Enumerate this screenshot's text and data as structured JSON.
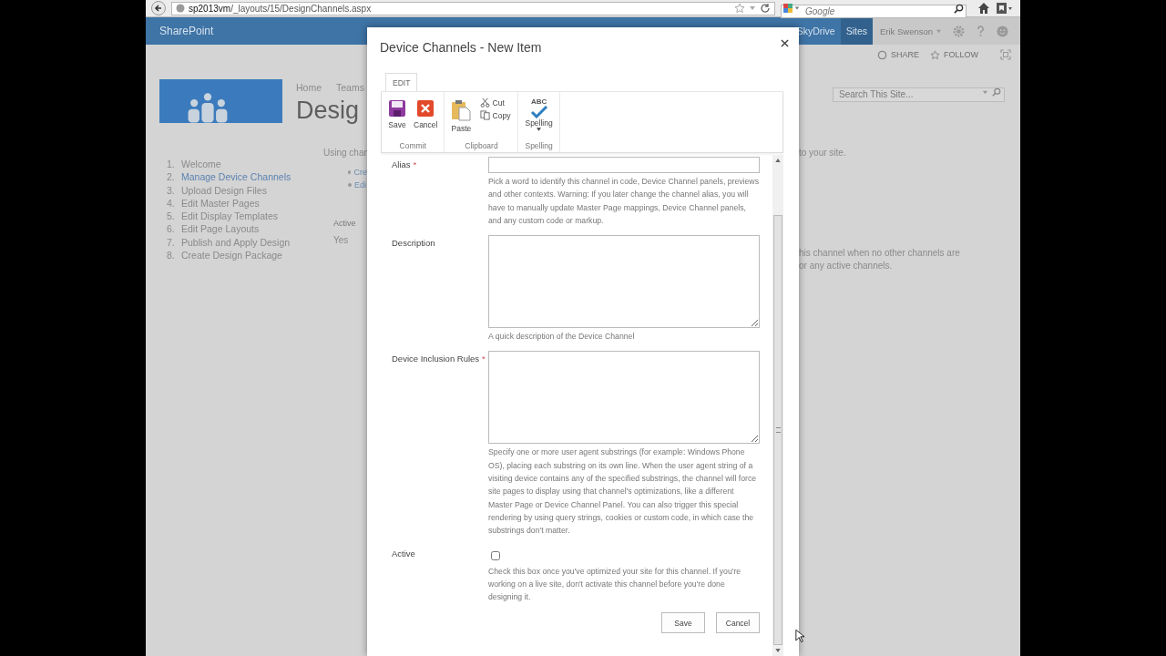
{
  "browser": {
    "url_host": "sp2013vm",
    "url_path": "/_layouts/15/DesignChannels.aspx",
    "search_placeholder": "Google"
  },
  "suite_bar": {
    "brand": "SharePoint",
    "links": [
      {
        "label": "SkyDrive",
        "selected": false
      },
      {
        "label": "Sites",
        "selected": true
      }
    ],
    "user": "Erik Swenson"
  },
  "page_actions": [
    {
      "kind": "share",
      "label": "SHARE"
    },
    {
      "kind": "follow",
      "label": "FOLLOW"
    }
  ],
  "top_nav": [
    "Home",
    "Teams"
  ],
  "page_title": "Desig",
  "site_search": {
    "placeholder": "Search This Site..."
  },
  "steps": [
    {
      "number": "1.",
      "label": "Welcome",
      "selected": false
    },
    {
      "number": "2.",
      "label": "Manage Device Channels",
      "selected": true
    },
    {
      "number": "3.",
      "label": "Upload Design Files",
      "selected": false
    },
    {
      "number": "4.",
      "label": "Edit Master Pages",
      "selected": false
    },
    {
      "number": "5.",
      "label": "Edit Display Templates",
      "selected": false
    },
    {
      "number": "6.",
      "label": "Edit Page Layouts",
      "selected": false
    },
    {
      "number": "7.",
      "label": "Publish and Apply Design",
      "selected": false
    },
    {
      "number": "8.",
      "label": "Create Design Package",
      "selected": false
    }
  ],
  "main": {
    "intro": "Using chan",
    "links": [
      "Cre",
      "Edi"
    ],
    "column_label": "Active",
    "column_value": "Yes",
    "right_texts": [
      "to your site.",
      "his channel when no other channels are",
      "or any active channels."
    ]
  },
  "dialog": {
    "title": "Device Channels - New Item",
    "ribbon": {
      "tabs": [
        {
          "label": "EDIT",
          "selected": true
        }
      ],
      "groups": [
        {
          "label": "Commit",
          "buttons": [
            {
              "kind": "save",
              "label": "Save"
            },
            {
              "kind": "cancel",
              "label": "Cancel"
            }
          ]
        },
        {
          "label": "Clipboard",
          "buttons": [
            {
              "kind": "paste",
              "label": "Paste"
            },
            {
              "kind": "cut",
              "label": "Cut"
            },
            {
              "kind": "copy",
              "label": "Copy"
            }
          ]
        },
        {
          "label": "Spelling",
          "buttons": [
            {
              "kind": "spelling",
              "label": "Spelling",
              "icon_text": "ABC"
            }
          ]
        }
      ]
    },
    "fields": [
      {
        "kind": "text",
        "label": "Alias",
        "marker": "*",
        "help": "Pick a word to identify this channel in code, Device Channel panels, previews and other contexts. Warning: If you later change the channel alias, you will have to manually update Master Page mappings, Device Channel panels, and any custom code or markup."
      },
      {
        "kind": "textarea",
        "label": "Description",
        "help": "A quick description of the Device Channel"
      },
      {
        "kind": "textarea",
        "label": "Device Inclusion Rules",
        "marker": "*",
        "help": "Specify one or more user agent substrings (for example: Windows Phone OS), placing each substring on its own line. When the user agent string of a visiting device contains any of the specified substrings, the channel will force site pages to display using that channel's optimizations, like a different Master Page or Device Channel Panel. You can also trigger this special rendering by using query strings, cookies or custom code, in which case the substrings don't matter."
      },
      {
        "kind": "checkbox",
        "label": "Active",
        "checked": false,
        "help": "Check this box once you've optimized your site for this channel. If you're working on a live site, don't activate this channel before you're done designing it."
      }
    ],
    "buttons": [
      "Save",
      "Cancel"
    ]
  }
}
